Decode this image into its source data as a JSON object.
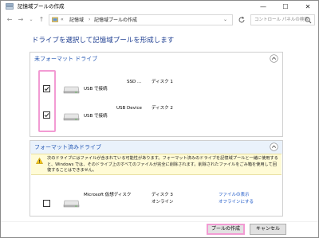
{
  "window": {
    "title": "記憶域プールの作成",
    "minimize": "—",
    "maximize": "☐",
    "close": "✕"
  },
  "addressbar": {
    "breadcrumb_prefix": "«",
    "breadcrumbs": [
      "記憶域",
      "記憶域プールの作成"
    ],
    "search_placeholder": "コントロール パネルの検索"
  },
  "heading": "ドライブを選択して記憶域プールを形成します",
  "unformatted": {
    "title": "未フォーマット ドライブ",
    "drives": [
      {
        "checked": true,
        "name": "USB で接続",
        "model": "SSD ...",
        "disk": "ディスク 1"
      },
      {
        "checked": true,
        "name": "USB で接続",
        "model": "USB Device",
        "disk": "ディスク 2"
      }
    ]
  },
  "formatted": {
    "title": "フォーマット済みドライブ",
    "warning": "次のドライブにはファイルが含まれている可能性があります。フォーマット済みのドライブを記憶域プールと一緒に使用すると、Windows では、そのドライブ上のすべてのファイルが完全に削除されます。削除されたファイルをごみ箱を使用して回復することはできません。",
    "drives": [
      {
        "checked": false,
        "name": "Microsoft 仮想ディスク",
        "disk": "ディスク 3",
        "status": "オンライン",
        "link1": "ファイルの表示",
        "link2": "オフラインにする"
      }
    ]
  },
  "buttons": {
    "create": "プールの作成",
    "cancel": "キャンセル"
  },
  "colors": {
    "heading": "#1f3f92",
    "section_title": "#2457b3",
    "link": "#1a56c7",
    "highlight": "#f29bd3",
    "warning_bg": "#fffbd6"
  }
}
